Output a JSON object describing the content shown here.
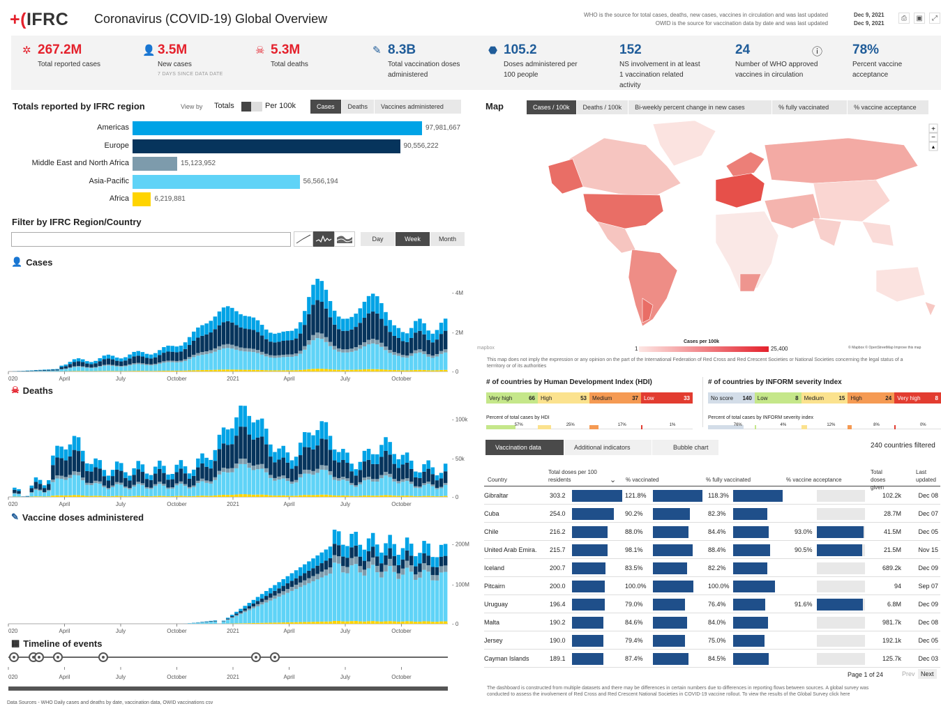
{
  "header": {
    "logo": "IFRC",
    "title": "Coronavirus (COVID-19) Global Overview",
    "source1": "WHO is the source for total cases, deaths, new cases, vaccines in circulation and was last updated",
    "source2": "OWID is the source for vaccination data by date and was last updated",
    "date1": "Dec 9, 2021",
    "date2": "Dec 9, 2021",
    "icons": [
      "print-icon",
      "image-icon",
      "expand-icon"
    ]
  },
  "kpis": [
    {
      "value": "267.2M",
      "label": "Total reported cases",
      "sub": "",
      "color": "#e4212c",
      "icon": "virus-icon"
    },
    {
      "value": "3.5M",
      "label": "New cases",
      "sub": "7 DAYS SINCE DATA DATE",
      "color": "#e4212c",
      "icon": "add-person-icon"
    },
    {
      "value": "5.3M",
      "label": "Total deaths",
      "sub": "",
      "color": "#e4212c",
      "icon": "skull-icon"
    },
    {
      "value": "8.3B",
      "label": "Total vaccination doses administered",
      "sub": "",
      "color": "#1f5c99",
      "icon": "syringe-icon"
    },
    {
      "value": "105.2",
      "label": "Doses administered per 100 people",
      "sub": "",
      "color": "#1f5c99",
      "icon": "vial-icon"
    },
    {
      "value": "152",
      "label": "NS involvement in at least 1 vaccination related activity",
      "sub": "",
      "color": "#1f5c99",
      "icon": ""
    },
    {
      "value": "24",
      "label": "Number of WHO approved vaccines in circulation",
      "sub": "",
      "color": "#1f5c99",
      "icon": "info-icon"
    },
    {
      "value": "78%",
      "label": "Percent vaccine acceptance",
      "sub": "",
      "color": "#1f5c99",
      "icon": ""
    }
  ],
  "regions": {
    "title": "Totals reported by IFRC region",
    "viewby": "View by",
    "totals": "Totals",
    "per100k": "Per 100k",
    "tabs": [
      "Cases",
      "Deaths",
      "Vaccines administered"
    ],
    "bars": [
      {
        "name": "Americas",
        "value": 97981667,
        "label": "97,981,667",
        "color": "#00a3e6"
      },
      {
        "name": "Europe",
        "value": 90556222,
        "label": "90,556,222",
        "color": "#06345c"
      },
      {
        "name": "Middle East and North Africa",
        "value": 15123952,
        "label": "15,123,952",
        "color": "#7d9bac"
      },
      {
        "name": "Asia-Pacific",
        "value": 56566194,
        "label": "56,566,194",
        "color": "#5fd3f7"
      },
      {
        "name": "Africa",
        "value": 6219881,
        "label": "6,219,881",
        "color": "#ffd400"
      }
    ]
  },
  "filter": {
    "title": "Filter by IFRC Region/Country",
    "placeholder": "",
    "period": [
      "Day",
      "Week",
      "Month"
    ]
  },
  "charts": {
    "cases": "Cases",
    "deaths": "Deaths",
    "vaccines": "Vaccine doses administered",
    "timeline": "Timeline of events",
    "xticks": [
      "020",
      "April",
      "July",
      "October",
      "2021",
      "April",
      "July",
      "October"
    ],
    "cases_y": [
      "4M",
      "2M",
      "0"
    ],
    "deaths_y": [
      "100k",
      "50k",
      "0"
    ],
    "vacc_y": [
      "200M",
      "100M",
      "0"
    ],
    "datasources": "Data Sources - WHO Daily cases and deaths by date, vaccination data, OWID vaccinations csv"
  },
  "map": {
    "title": "Map",
    "tabs": [
      "Cases / 100k",
      "Deaths / 100k",
      "Bi-weekly percent change in new cases",
      "% fully vaccinated",
      "% vaccine acceptance"
    ],
    "legend_title": "Cases per 100k",
    "legend_min": "1",
    "legend_max": "25,400",
    "credit": "© Mapbox © OpenStreetMap Improve this map",
    "mapbox": "mapbox",
    "disclaimer": "This map does not imply the expression or any opinion on the part of the International Federation of Red Cross and Red Crescent Societies or National Societies concerning the legal status of a terrritory or of its authorities"
  },
  "hdi": {
    "title": "# of countries by Human Development Index (HDI)",
    "cats": [
      {
        "n": "Very high",
        "c": "66",
        "col": "#c5e78a"
      },
      {
        "n": "High",
        "c": "53",
        "col": "#fbe28e"
      },
      {
        "n": "Medium",
        "c": "37",
        "col": "#f59a53"
      },
      {
        "n": "Low",
        "c": "33",
        "col": "#e23c30"
      }
    ],
    "pct_title": "Percent of total cases by HDI",
    "pcts": [
      "57%",
      "25%",
      "17%",
      "1%"
    ]
  },
  "inform": {
    "title": "# of countries by INFORM severity Index",
    "cats": [
      {
        "n": "No score",
        "c": "140",
        "col": "#d3dde8"
      },
      {
        "n": "Low",
        "c": "8",
        "col": "#c5e78a"
      },
      {
        "n": "Medium",
        "c": "15",
        "col": "#fbe28e"
      },
      {
        "n": "High",
        "c": "24",
        "col": "#f59a53"
      },
      {
        "n": "Very high",
        "c": "8",
        "col": "#e23c30"
      }
    ],
    "pct_title": "Percent of total cases by INFORM severity index",
    "pcts": [
      "76%",
      "4%",
      "12%",
      "8%",
      "0%"
    ]
  },
  "table": {
    "tabs": [
      "Vaccination data",
      "Additional indicators",
      "Bubble chart"
    ],
    "filtered": "240 countries filtered",
    "headers": [
      "Country",
      "Total doses per 100 residents",
      "% vaccinated",
      "% fully vaccinated",
      "% vaccine acceptance",
      "Total doses given",
      "Last updated"
    ],
    "rows": [
      {
        "country": "Gibraltar",
        "doses": "303.2",
        "vacc": "121.8%",
        "fully": "118.3%",
        "accept": "",
        "given": "102.2k",
        "updated": "Dec 08",
        "d": 303.2,
        "v": 121.8,
        "f": 118.3,
        "a": 0
      },
      {
        "country": "Cuba",
        "doses": "254.0",
        "vacc": "90.2%",
        "fully": "82.3%",
        "accept": "",
        "given": "28.7M",
        "updated": "Dec 07",
        "d": 254,
        "v": 90.2,
        "f": 82.3,
        "a": 0
      },
      {
        "country": "Chile",
        "doses": "216.2",
        "vacc": "88.0%",
        "fully": "84.4%",
        "accept": "93.0%",
        "given": "41.5M",
        "updated": "Dec 05",
        "d": 216.2,
        "v": 88,
        "f": 84.4,
        "a": 93
      },
      {
        "country": "United Arab Emira.",
        "doses": "215.7",
        "vacc": "98.1%",
        "fully": "88.4%",
        "accept": "90.5%",
        "given": "21.5M",
        "updated": "Nov 15",
        "d": 215.7,
        "v": 98.1,
        "f": 88.4,
        "a": 90.5
      },
      {
        "country": "Iceland",
        "doses": "200.7",
        "vacc": "83.5%",
        "fully": "82.2%",
        "accept": "",
        "given": "689.2k",
        "updated": "Dec 09",
        "d": 200.7,
        "v": 83.5,
        "f": 82.2,
        "a": 0
      },
      {
        "country": "Pitcairn",
        "doses": "200.0",
        "vacc": "100.0%",
        "fully": "100.0%",
        "accept": "",
        "given": "94",
        "updated": "Sep 07",
        "d": 200,
        "v": 100,
        "f": 100,
        "a": 0
      },
      {
        "country": "Uruguay",
        "doses": "196.4",
        "vacc": "79.0%",
        "fully": "76.4%",
        "accept": "91.6%",
        "given": "6.8M",
        "updated": "Dec 09",
        "d": 196.4,
        "v": 79,
        "f": 76.4,
        "a": 91.6
      },
      {
        "country": "Malta",
        "doses": "190.2",
        "vacc": "84.6%",
        "fully": "84.0%",
        "accept": "",
        "given": "981.7k",
        "updated": "Dec 08",
        "d": 190.2,
        "v": 84.6,
        "f": 84,
        "a": 0
      },
      {
        "country": "Jersey",
        "doses": "190.0",
        "vacc": "79.4%",
        "fully": "75.0%",
        "accept": "",
        "given": "192.1k",
        "updated": "Dec 05",
        "d": 190,
        "v": 79.4,
        "f": 75,
        "a": 0
      },
      {
        "country": "Cayman Islands",
        "doses": "189.1",
        "vacc": "87.4%",
        "fully": "84.5%",
        "accept": "",
        "given": "125.7k",
        "updated": "Dec 03",
        "d": 189.1,
        "v": 87.4,
        "f": 84.5,
        "a": 0
      }
    ],
    "page": "Page 1 of 24",
    "prev": "Prev",
    "next": "Next",
    "footnote": "The dashboard is constructed from multiple datasets and there may be differences in certain numbers due to differences in reporting flows between sources. A global survey was conducted to assess the involvement of Red Cross and Red Crescent National Societies in COVID-19 vaccine rollout. To view the results of the Global Survey click here"
  }
}
